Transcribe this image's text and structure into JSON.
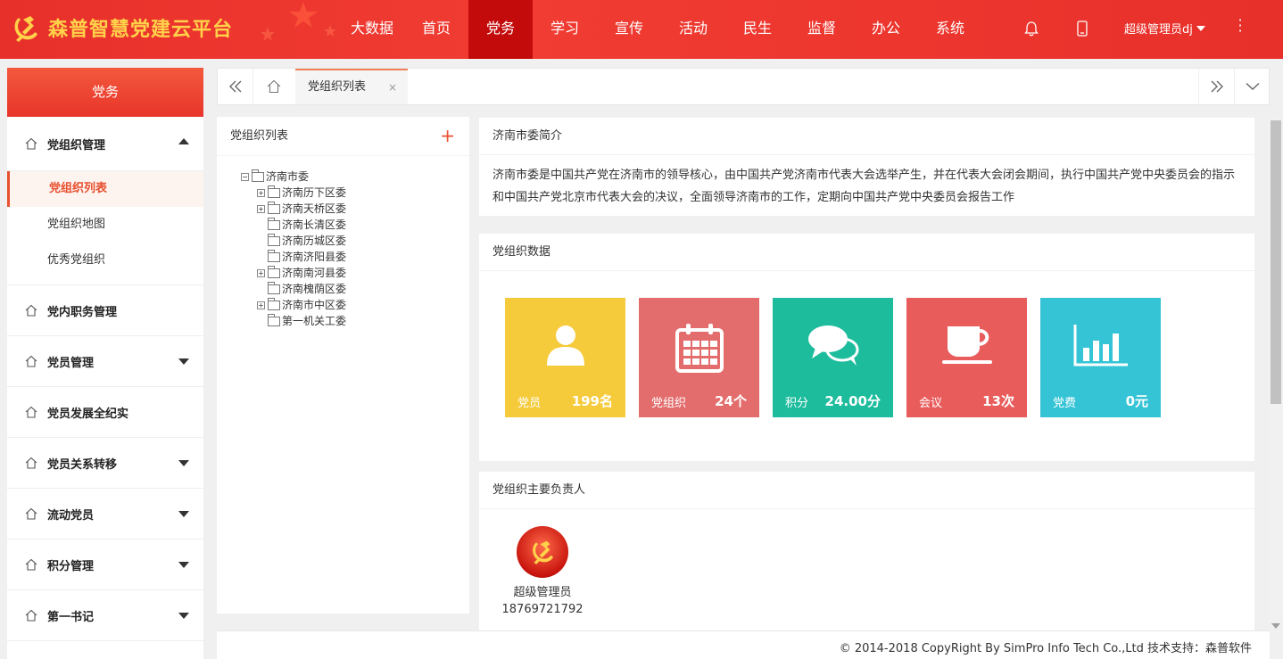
{
  "app": {
    "title": "森普智慧党建云平台"
  },
  "nav": {
    "items": [
      "大数据",
      "首页",
      "党务",
      "学习",
      "宣传",
      "活动",
      "民生",
      "监督",
      "办公",
      "系统"
    ],
    "active_index": 2
  },
  "header": {
    "user_label": "超级管理员dj",
    "icons": [
      "bell-icon",
      "mobile-icon",
      "more-icon"
    ]
  },
  "sidebar": {
    "title": "党务",
    "groups": [
      {
        "label": "党组织管理",
        "expanded": true,
        "subitems": [
          "党组织列表",
          "党组织地图",
          "优秀党组织"
        ],
        "active_sub": 0
      },
      {
        "label": "党内职务管理",
        "caret": false
      },
      {
        "label": "党员管理",
        "caret": true
      },
      {
        "label": "党员发展全纪实",
        "caret": false
      },
      {
        "label": "党员关系转移",
        "caret": true
      },
      {
        "label": "流动党员",
        "caret": true
      },
      {
        "label": "积分管理",
        "caret": true
      },
      {
        "label": "第一书记",
        "caret": true
      }
    ]
  },
  "tabs": {
    "items": [
      {
        "label": "党组织列表",
        "close": "×"
      }
    ]
  },
  "tree_panel": {
    "title": "党组织列表",
    "add_label": "+",
    "root": {
      "label": "济南市委",
      "toggle": "⊟"
    },
    "children": [
      {
        "label": "济南历下区委",
        "toggle": "⊞"
      },
      {
        "label": "济南天桥区委",
        "toggle": "⊞"
      },
      {
        "label": "济南长清区委",
        "toggle": ""
      },
      {
        "label": "济南历城区委",
        "toggle": ""
      },
      {
        "label": "济南济阳县委",
        "toggle": ""
      },
      {
        "label": "济南南河县委",
        "toggle": "⊞"
      },
      {
        "label": "济南槐荫区委",
        "toggle": ""
      },
      {
        "label": "济南市中区委",
        "toggle": "⊞"
      },
      {
        "label": "第一机关工委",
        "toggle": ""
      }
    ]
  },
  "intro": {
    "title": "济南市委简介",
    "text": "济南市委是中国共产党在济南市的领导核心，由中国共产党济南市代表大会选举产生，并在代表大会闭会期间，执行中国共产党中央委员会的指示和中国共产党北京市代表大会的决议，全面领导济南市的工作，定期向中国共产党中央委员会报告工作"
  },
  "stats": {
    "title": "党组织数据",
    "items": [
      {
        "label": "党员",
        "value": "199名",
        "color": "#f5cb3c",
        "icon": "user-icon"
      },
      {
        "label": "党组织",
        "value": "24个",
        "color": "#e36d6d",
        "icon": "calendar-icon"
      },
      {
        "label": "积分",
        "value": "24.00分",
        "color": "#1dbc9c",
        "icon": "chat-icon"
      },
      {
        "label": "会议",
        "value": "13次",
        "color": "#e85c5c",
        "icon": "cup-icon"
      },
      {
        "label": "党费",
        "value": "0元",
        "color": "#35c4d6",
        "icon": "bar-chart-icon"
      }
    ]
  },
  "leaders": {
    "title": "党组织主要负责人",
    "items": [
      {
        "name": "超级管理员",
        "phone": "18769721792"
      }
    ]
  },
  "footer": {
    "text": "© 2014-2018 CopyRight By SimPro Info Tech Co.,Ltd 技术支持：森普软件"
  },
  "colors": {
    "header_red": "#e8302a",
    "nav_active": "#c40b0b",
    "accent_orange": "#e8502f",
    "logo_gold": "#ffd24a"
  }
}
